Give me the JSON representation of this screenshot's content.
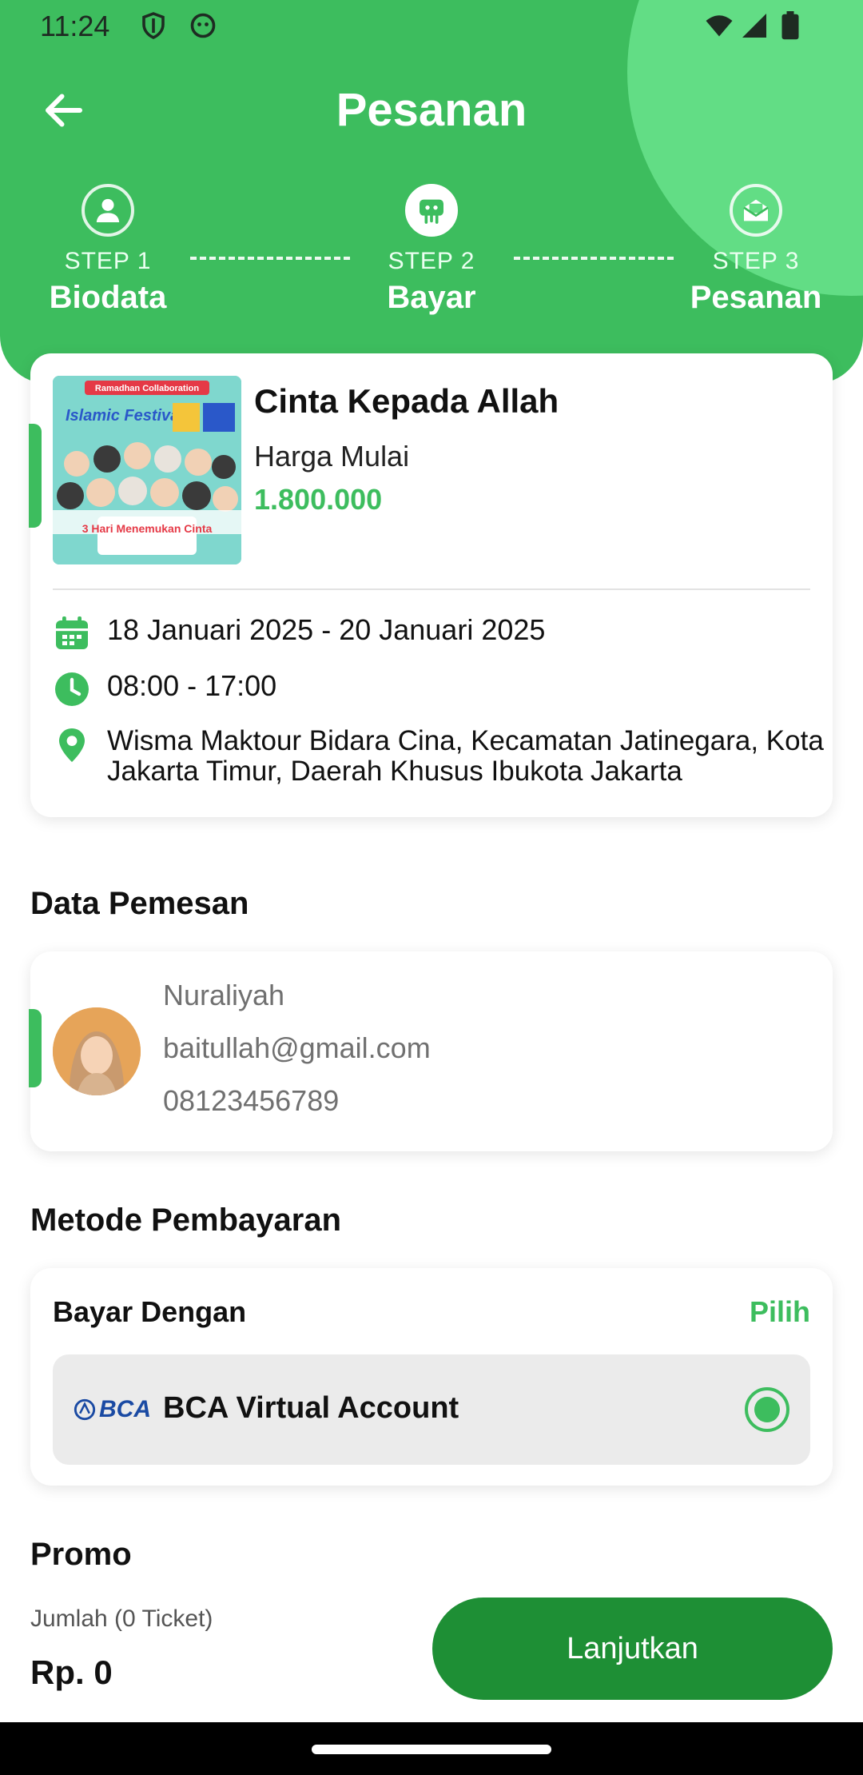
{
  "status_bar": {
    "time": "11:24"
  },
  "header": {
    "title": "Pesanan"
  },
  "steps": [
    {
      "num": "STEP 1",
      "name": "Biodata"
    },
    {
      "num": "STEP 2",
      "name": "Bayar"
    },
    {
      "num": "STEP 3",
      "name": "Pesanan"
    }
  ],
  "event": {
    "title": "Cinta Kepada Allah",
    "price_label": "Harga Mulai",
    "price": "1.800.000",
    "date": "18 Januari 2025 - 20 Januari 2025",
    "time": "08:00 - 17:00",
    "location": "Wisma Maktour Bidara Cina, Kecamatan Jatinegara, Kota Jakarta Timur, Daerah Khusus Ibukota Jakarta",
    "poster": {
      "badge": "Ramadhan Collaboration",
      "logo": "Islamic Festival",
      "tagline": "3 Hari Menemukan Cinta"
    }
  },
  "data_pemesan": {
    "section_title": "Data Pemesan",
    "name": "Nuraliyah",
    "email": "baitullah@gmail.com",
    "phone": "08123456789"
  },
  "metode": {
    "section_title": "Metode Pembayaran",
    "label": "Bayar Dengan",
    "action": "Pilih",
    "method_logo": "BCA",
    "method_name": "BCA Virtual Account"
  },
  "promo": {
    "section_title": "Promo"
  },
  "footer": {
    "jumlah_label": "Jumlah (0 Ticket)",
    "total": "Rp. 0",
    "cta": "Lanjutkan"
  },
  "colors": {
    "primary": "#3dbd5e",
    "cta": "#1e8f35",
    "header_circle": "#62dd85"
  }
}
